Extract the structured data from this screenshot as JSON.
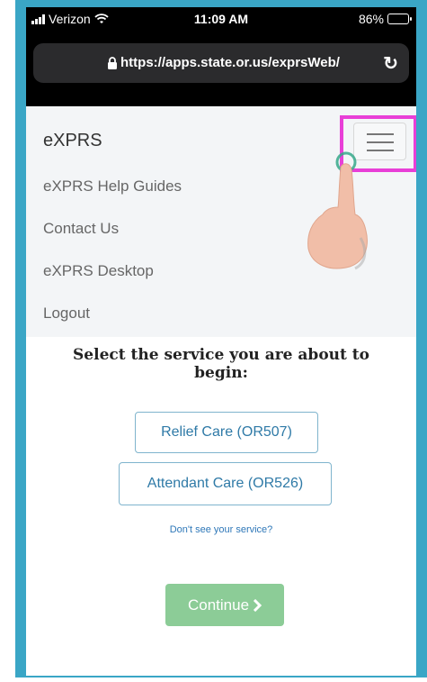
{
  "status_bar": {
    "carrier": "Verizon",
    "time": "11:09 AM",
    "battery": "86%",
    "battery_level": 0.86
  },
  "browser": {
    "url": "https://apps.state.or.us/exprsWeb/"
  },
  "navbar": {
    "brand": "eXPRS",
    "items": [
      {
        "label": "eXPRS Help Guides"
      },
      {
        "label": "Contact Us"
      },
      {
        "label": "eXPRS Desktop"
      },
      {
        "label": "Logout"
      }
    ],
    "highlight_color": "#e83fd7"
  },
  "main": {
    "prompt": "Select the service you are about to begin:",
    "services": [
      {
        "label": "Relief Care (OR507)"
      },
      {
        "label": "Attendant Care (OR526)"
      }
    ],
    "help_link": "Don't see your service?",
    "continue_label": "Continue",
    "continue_color": "#8ccc97"
  },
  "icons": [
    "wifi-icon",
    "lock-icon",
    "reload-icon",
    "hamburger-icon",
    "pointing-hand-icon",
    "chevron-right-icon"
  ]
}
